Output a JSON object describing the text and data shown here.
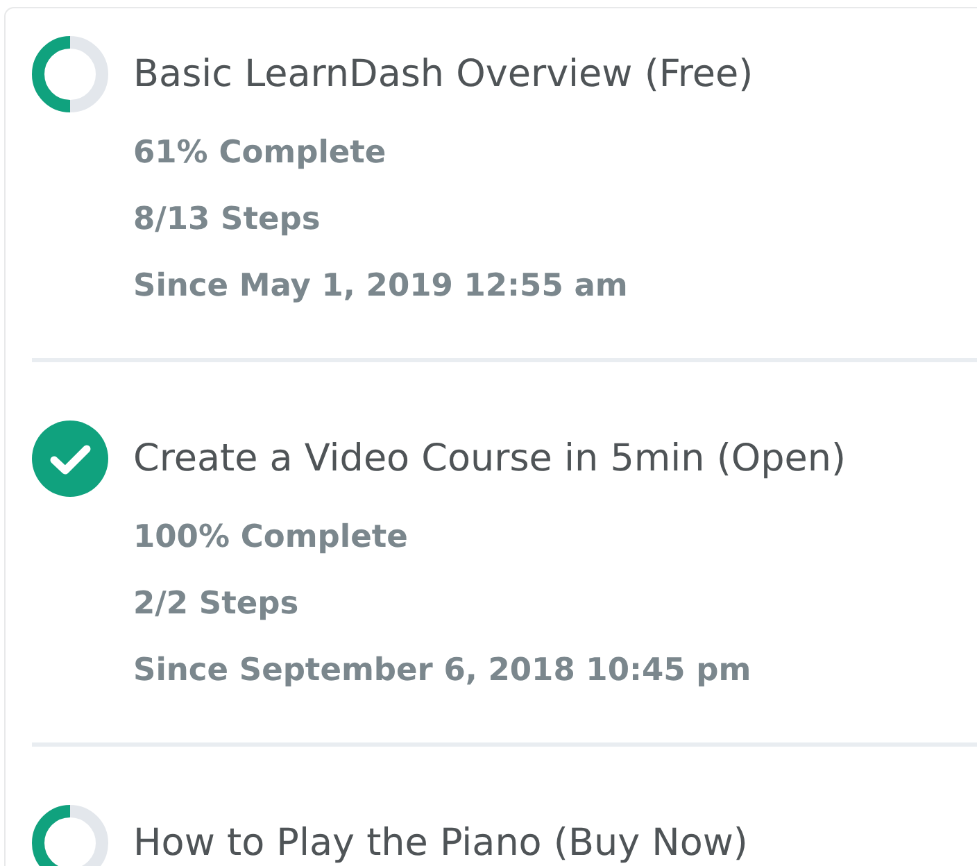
{
  "courses": [
    {
      "title": "Basic LearnDash Overview (Free)",
      "status": {
        "kind": "progress",
        "level": 0.5
      },
      "details": [
        "61% Complete",
        "8/13 Steps",
        "Since May 1, 2019 12:55 am"
      ]
    },
    {
      "title": "Create a Video Course in 5min (Open)",
      "status": {
        "kind": "complete"
      },
      "details": [
        "100% Complete",
        "2/2 Steps",
        "Since September 6, 2018 10:45 pm"
      ]
    },
    {
      "title": "How to Play the Piano (Buy Now)",
      "status": {
        "kind": "progress",
        "level": 0.5
      }
    }
  ]
}
